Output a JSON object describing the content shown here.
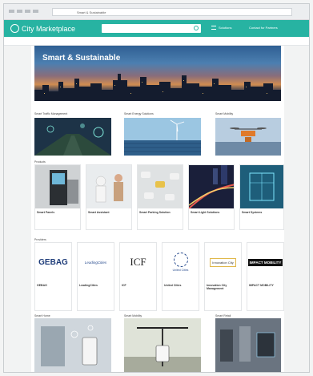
{
  "browser": {
    "url": "Smart & Sustainable"
  },
  "header": {
    "brand": "City Marketplace",
    "link_a": "Solutions",
    "link_b": "Contact for Partners",
    "brand_color": "#27b3a2"
  },
  "nav": {
    "items": [
      "",
      "",
      "",
      "",
      "",
      "",
      "",
      ""
    ]
  },
  "hero": {
    "title": "Smart & Sustainable"
  },
  "row1": {
    "labels": [
      "Smart Traffic Management",
      "Smart Energy Solutions",
      "Smart Mobility"
    ]
  },
  "products": {
    "heading": "Products",
    "items": [
      {
        "title": "Smart Panels",
        "desc": ""
      },
      {
        "title": "Smart Assistant",
        "desc": ""
      },
      {
        "title": "Smart Parking Solution",
        "desc": ""
      },
      {
        "title": "Smart Light Solutions",
        "desc": ""
      },
      {
        "title": "Smart Systems",
        "desc": ""
      }
    ]
  },
  "providers": {
    "heading": "Providers",
    "items": [
      {
        "logo": "GEBAG",
        "title": "GEBAG"
      },
      {
        "logo": "LeadingCities",
        "title": "LeadingCities"
      },
      {
        "logo": "ICF",
        "title": "ICF"
      },
      {
        "logo": "United Cities",
        "title": "United Cities"
      },
      {
        "logo": "Innovation City",
        "title": "Innovation City Management"
      },
      {
        "logo": "IMPACT MOBILITY",
        "title": "IMPACT MOBILITY"
      }
    ]
  },
  "row3": {
    "labels": [
      "Smart Home",
      "Smart Mobility",
      "Smart Retail"
    ]
  }
}
